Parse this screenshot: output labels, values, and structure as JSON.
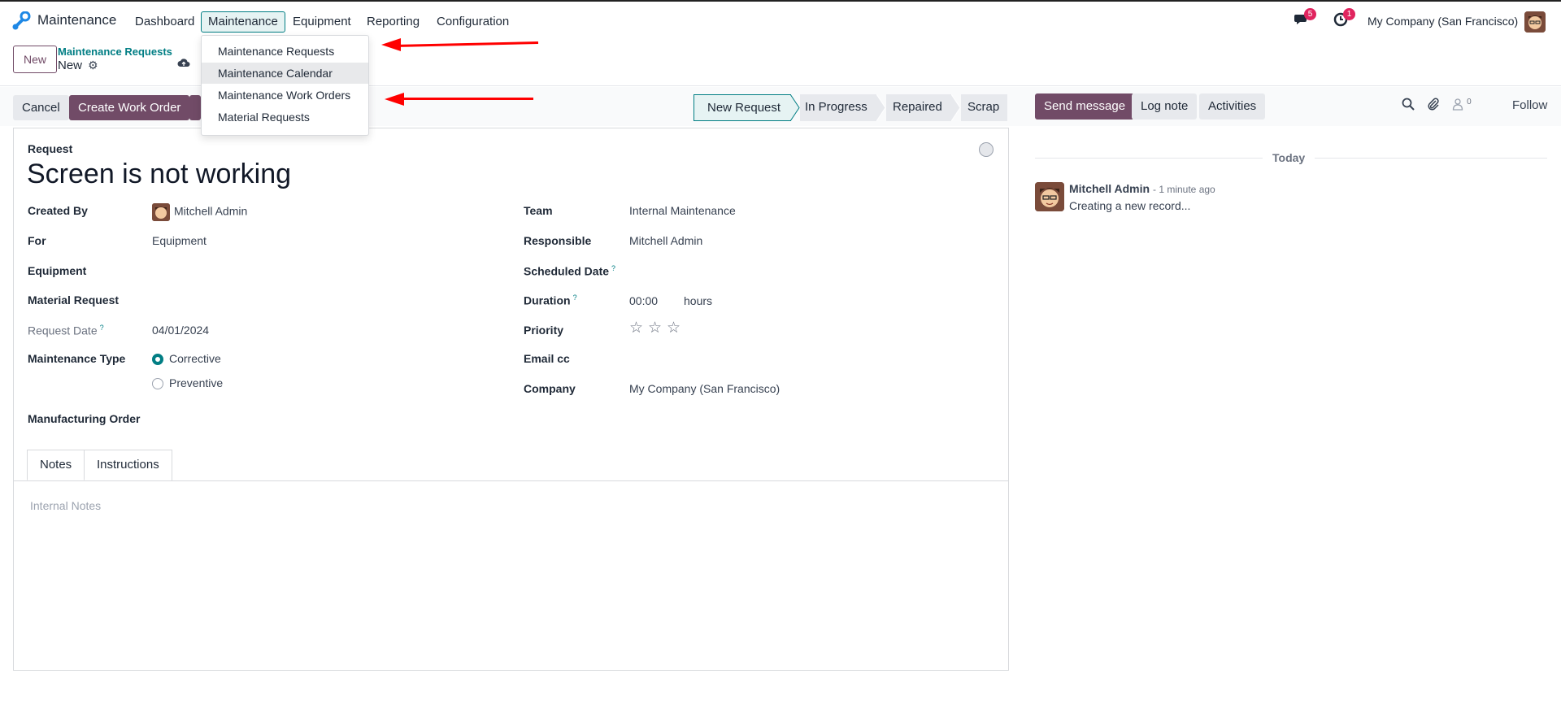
{
  "navbar": {
    "app_name": "Maintenance",
    "menu": [
      "Dashboard",
      "Maintenance",
      "Equipment",
      "Reporting",
      "Configuration"
    ],
    "messages_count": "5",
    "activities_count": "1",
    "company": "My Company (San Francisco)"
  },
  "control_panel": {
    "new_label": "New",
    "breadcrumb_parent": "Maintenance Requests",
    "breadcrumb_current": "New"
  },
  "dropdown": {
    "items": [
      "Maintenance Requests",
      "Maintenance Calendar",
      "Maintenance Work Orders",
      "Material Requests"
    ]
  },
  "form_buttons": {
    "cancel": "Cancel",
    "create_work_order": "Create Work Order"
  },
  "stages": [
    "New Request",
    "In Progress",
    "Repaired",
    "Scrap"
  ],
  "form": {
    "title_label": "Request",
    "title_value": "Screen is not working",
    "created_by_label": "Created By",
    "created_by_value": "Mitchell Admin",
    "for_label": "For",
    "for_value": "Equipment",
    "equipment_label": "Equipment",
    "material_request_label": "Material Request",
    "request_date_label": "Request Date",
    "request_date_value": "04/01/2024",
    "maintenance_type_label": "Maintenance Type",
    "maintenance_type_options": [
      "Corrective",
      "Preventive"
    ],
    "maintenance_type_selected": "Corrective",
    "manufacturing_order_label": "Manufacturing Order",
    "team_label": "Team",
    "team_value": "Internal Maintenance",
    "responsible_label": "Responsible",
    "responsible_value": "Mitchell Admin",
    "scheduled_date_label": "Scheduled Date",
    "duration_label": "Duration",
    "duration_value": "00:00",
    "duration_unit": "hours",
    "priority_label": "Priority",
    "email_cc_label": "Email cc",
    "company_label": "Company",
    "company_value": "My Company (San Francisco)",
    "help_mark": "?",
    "tabs": [
      "Notes",
      "Instructions"
    ],
    "notes_placeholder": "Internal Notes"
  },
  "chatter": {
    "send_message": "Send message",
    "log_note": "Log note",
    "activities": "Activities",
    "followers_count": "0",
    "follow": "Follow",
    "date_separator": "Today",
    "message_author": "Mitchell Admin",
    "message_time": "- 1 minute ago",
    "message_body": "Creating a new record..."
  },
  "colors": {
    "brand": "#714b67",
    "accent": "#017e84",
    "badge": "#e0245e",
    "annotation_arrow": "#ff0000"
  }
}
